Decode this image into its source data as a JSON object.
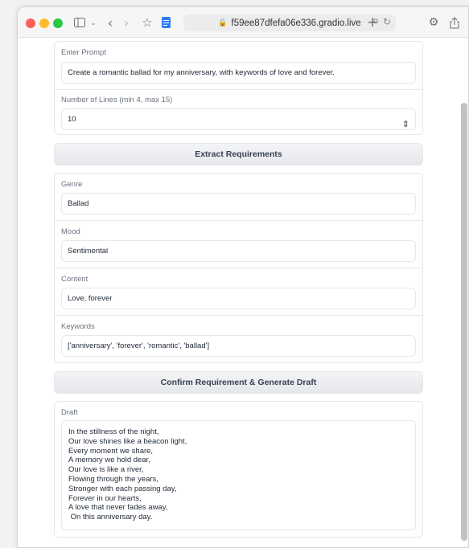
{
  "browser": {
    "url": "f59ee87dfefa06e336.gradio.live"
  },
  "prompt_section": {
    "prompt_label": "Enter Prompt",
    "prompt_value": "Create a romantic ballad for my anniversary, with keywords of love and forever.",
    "lines_label": "Number of Lines (min 4, max 15)",
    "lines_value": "10"
  },
  "extract_button": "Extract Requirements",
  "requirements": {
    "genre_label": "Genre",
    "genre_value": "Ballad",
    "mood_label": "Mood",
    "mood_value": "Sentimental",
    "content_label": "Content",
    "content_value": "Love, forever",
    "keywords_label": "Keywords",
    "keywords_value": "['anniversary', 'forever', 'romantic', 'ballad']"
  },
  "generate_button": "Confirm Requirement & Generate Draft",
  "draft": {
    "label": "Draft",
    "lines": [
      "In the stillness of the night,",
      "Our love shines like a beacon light,",
      "Every moment we share,",
      "A memory we hold dear,",
      "Our love is like a river,",
      "Flowing through the years,",
      "Stronger with each passing day,",
      "Forever in our hearts,",
      "A love that never fades away,",
      " On this anniversary day."
    ]
  }
}
